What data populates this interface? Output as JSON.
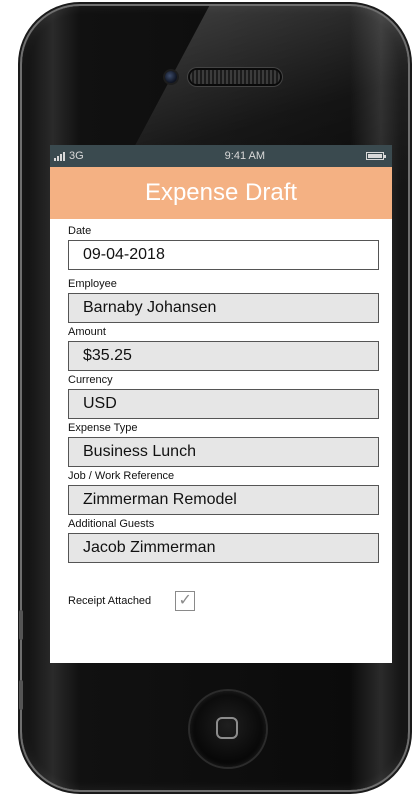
{
  "status_bar": {
    "carrier": "3G",
    "time": "9:41 AM",
    "icons": [
      "signal-bars-icon",
      "battery-icon"
    ]
  },
  "header": {
    "title": "Expense Draft"
  },
  "form": {
    "date": {
      "label": "Date",
      "value": "09-04-2018"
    },
    "employee": {
      "label": "Employee",
      "value": "Barnaby Johansen"
    },
    "amount": {
      "label": "Amount",
      "value": "$35.25"
    },
    "currency": {
      "label": "Currency",
      "value": "USD"
    },
    "expense_type": {
      "label": "Expense Type",
      "value": "Business Lunch"
    },
    "job_reference": {
      "label": "Job / Work Reference",
      "value": "Zimmerman Remodel"
    },
    "guests": {
      "label": "Additional Guests",
      "value": "Jacob Zimmerman"
    },
    "receipt": {
      "label": "Receipt Attached",
      "checked": true,
      "check_glyph": "✓"
    }
  },
  "colors": {
    "header_bg": "#f4b183",
    "status_bar_bg": "#3a4a4f",
    "field_bg": "#e6e6e6",
    "field_border": "#555555"
  }
}
